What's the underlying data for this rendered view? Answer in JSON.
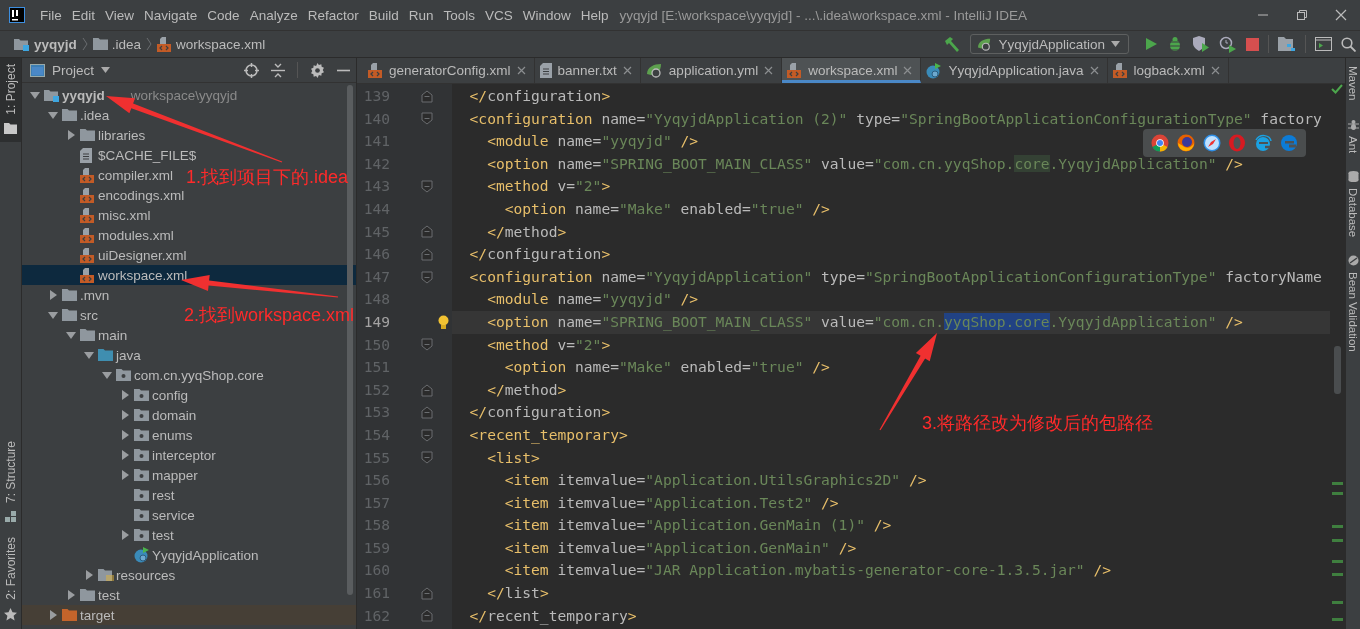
{
  "menu": [
    "File",
    "Edit",
    "View",
    "Navigate",
    "Code",
    "Analyze",
    "Refactor",
    "Build",
    "Run",
    "Tools",
    "VCS",
    "Window",
    "Help"
  ],
  "window_title": "yyqyjd [E:\\workspace\\yyqyjd] - ...\\.idea\\workspace.xml - IntelliJ IDEA",
  "breadcrumbs": [
    {
      "label": "yyqyjd",
      "kind": "project"
    },
    {
      "label": ".idea",
      "kind": "folder"
    },
    {
      "label": "workspace.xml",
      "kind": "xml"
    }
  ],
  "run_config": "YyqyjdApplication",
  "left_strip": [
    {
      "label": "1: Project",
      "selected": true
    },
    {
      "label": "7: Structure",
      "selected": false
    },
    {
      "label": "2: Favorites",
      "selected": false
    }
  ],
  "right_strip": [
    "Maven",
    "Ant",
    "Database",
    "Bean Validation"
  ],
  "project_panel": {
    "title": "Project",
    "tree": [
      {
        "label": "yyqyjd",
        "kind": "project",
        "hint": "workspace\\yyqyjd",
        "expanded": true,
        "selected": false,
        "children": [
          {
            "label": ".idea",
            "kind": "folder",
            "expanded": true,
            "selected": false,
            "children": [
              {
                "label": "libraries",
                "kind": "folder",
                "expanded": false,
                "selected": false
              },
              {
                "label": "$CACHE_FILE$",
                "kind": "text",
                "selected": false
              },
              {
                "label": "compiler.xml",
                "kind": "xml",
                "selected": false
              },
              {
                "label": "encodings.xml",
                "kind": "xml",
                "selected": false
              },
              {
                "label": "misc.xml",
                "kind": "xml",
                "selected": false
              },
              {
                "label": "modules.xml",
                "kind": "xml",
                "selected": false
              },
              {
                "label": "uiDesigner.xml",
                "kind": "xml",
                "selected": false
              },
              {
                "label": "workspace.xml",
                "kind": "xml",
                "selected": true
              }
            ]
          },
          {
            "label": ".mvn",
            "kind": "folder",
            "expanded": false,
            "selected": false
          },
          {
            "label": "src",
            "kind": "folder",
            "expanded": true,
            "selected": false,
            "children": [
              {
                "label": "main",
                "kind": "folder",
                "expanded": true,
                "selected": false,
                "children": [
                  {
                    "label": "java",
                    "kind": "source",
                    "expanded": true,
                    "selected": false,
                    "children": [
                      {
                        "label": "com.cn.yyqShop.core",
                        "kind": "package",
                        "expanded": true,
                        "selected": false,
                        "children": [
                          {
                            "label": "config",
                            "kind": "package",
                            "expanded": false,
                            "selected": false
                          },
                          {
                            "label": "domain",
                            "kind": "package",
                            "expanded": false,
                            "selected": false
                          },
                          {
                            "label": "enums",
                            "kind": "package",
                            "expanded": false,
                            "selected": false
                          },
                          {
                            "label": "interceptor",
                            "kind": "package",
                            "expanded": false,
                            "selected": false
                          },
                          {
                            "label": "mapper",
                            "kind": "package",
                            "expanded": false,
                            "selected": false
                          },
                          {
                            "label": "rest",
                            "kind": "package",
                            "selected": false
                          },
                          {
                            "label": "service",
                            "kind": "package",
                            "selected": false
                          },
                          {
                            "label": "test",
                            "kind": "package",
                            "expanded": false,
                            "selected": false
                          },
                          {
                            "label": "YyqyjdApplication",
                            "kind": "class",
                            "selected": false
                          }
                        ]
                      }
                    ]
                  },
                  {
                    "label": "resources",
                    "kind": "resources",
                    "expanded": false,
                    "selected": false
                  }
                ]
              },
              {
                "label": "test",
                "kind": "folder",
                "expanded": false,
                "selected": false
              }
            ]
          },
          {
            "label": "target",
            "kind": "excluded",
            "expanded": false,
            "selected": false
          }
        ]
      }
    ]
  },
  "tabs": [
    {
      "label": "generatorConfig.xml",
      "kind": "xml",
      "selected": false
    },
    {
      "label": "banner.txt",
      "kind": "text",
      "selected": false
    },
    {
      "label": "application.yml",
      "kind": "yml",
      "selected": false
    },
    {
      "label": "workspace.xml",
      "kind": "xml",
      "selected": true
    },
    {
      "label": "YyqyjdApplication.java",
      "kind": "class",
      "selected": false
    },
    {
      "label": "logback.xml",
      "kind": "xml",
      "selected": false
    }
  ],
  "editor": {
    "lines": [
      {
        "number": "139",
        "kind": "fold-end",
        "current": false,
        "segments": [
          {
            "text": "  </configuration>",
            "kind": "code"
          }
        ]
      },
      {
        "number": "140",
        "kind": "fold-start",
        "current": false,
        "segments": [
          {
            "text": "  <configuration name=\"YyqyjdApplication (2)\" type=\"SpringBootApplicationConfigurationType\" factory",
            "kind": "code"
          }
        ]
      },
      {
        "number": "141",
        "kind": "plain",
        "current": false,
        "segments": [
          {
            "text": "    <module name=\"yyqyjd\" />",
            "kind": "code"
          }
        ]
      },
      {
        "number": "142",
        "kind": "plain",
        "current": false,
        "segments": [
          {
            "text": "    <option name=\"SPRING_BOOT_MAIN_CLASS\" value=\"com.cn.yyqShop.",
            "kind": "code"
          },
          {
            "text": "core",
            "kind": "match"
          },
          {
            "text": ".YyqyjdApplication\" />",
            "kind": "code"
          }
        ]
      },
      {
        "number": "143",
        "kind": "fold-start",
        "current": false,
        "segments": [
          {
            "text": "    <method v=\"2\">",
            "kind": "code"
          }
        ]
      },
      {
        "number": "144",
        "kind": "plain",
        "current": false,
        "segments": [
          {
            "text": "      <option name=\"Make\" enabled=\"true\" />",
            "kind": "code"
          }
        ]
      },
      {
        "number": "145",
        "kind": "fold-end",
        "current": false,
        "segments": [
          {
            "text": "    </method>",
            "kind": "code"
          }
        ]
      },
      {
        "number": "146",
        "kind": "fold-end",
        "current": false,
        "segments": [
          {
            "text": "  </configuration>",
            "kind": "code"
          }
        ]
      },
      {
        "number": "147",
        "kind": "fold-start",
        "current": false,
        "segments": [
          {
            "text": "  <configuration name=\"YyqyjdApplication\" type=\"SpringBootApplicationConfigurationType\" factoryName",
            "kind": "code"
          }
        ]
      },
      {
        "number": "148",
        "kind": "plain",
        "current": false,
        "segments": [
          {
            "text": "    <module name=\"yyqyjd\" />",
            "kind": "code"
          }
        ]
      },
      {
        "number": "149",
        "kind": "plain",
        "current": true,
        "segments": [
          {
            "text": "    <option name=\"SPRING_BOOT_MAIN_CLASS\" value=\"com.cn.",
            "kind": "code"
          },
          {
            "text": "yyqShop.core",
            "kind": "selection"
          },
          {
            "text": ".YyqyjdApplication\" />",
            "kind": "code"
          }
        ]
      },
      {
        "number": "150",
        "kind": "fold-start",
        "current": false,
        "segments": [
          {
            "text": "    <method v=\"2\">",
            "kind": "code"
          }
        ]
      },
      {
        "number": "151",
        "kind": "plain",
        "current": false,
        "segments": [
          {
            "text": "      <option name=\"Make\" enabled=\"true\" />",
            "kind": "code"
          }
        ]
      },
      {
        "number": "152",
        "kind": "fold-end",
        "current": false,
        "segments": [
          {
            "text": "    </method>",
            "kind": "code"
          }
        ]
      },
      {
        "number": "153",
        "kind": "fold-end",
        "current": false,
        "segments": [
          {
            "text": "  </configuration>",
            "kind": "code"
          }
        ]
      },
      {
        "number": "154",
        "kind": "fold-start",
        "current": false,
        "segments": [
          {
            "text": "  <recent_temporary>",
            "kind": "code"
          }
        ]
      },
      {
        "number": "155",
        "kind": "fold-start",
        "current": false,
        "segments": [
          {
            "text": "    <list>",
            "kind": "code"
          }
        ]
      },
      {
        "number": "156",
        "kind": "plain",
        "current": false,
        "segments": [
          {
            "text": "      <item itemvalue=\"Application.UtilsGraphics2D\" />",
            "kind": "code"
          }
        ]
      },
      {
        "number": "157",
        "kind": "plain",
        "current": false,
        "segments": [
          {
            "text": "      <item itemvalue=\"Application.Test2\" />",
            "kind": "code"
          }
        ]
      },
      {
        "number": "158",
        "kind": "plain",
        "current": false,
        "segments": [
          {
            "text": "      <item itemvalue=\"Application.GenMain (1)\" />",
            "kind": "code"
          }
        ]
      },
      {
        "number": "159",
        "kind": "plain",
        "current": false,
        "segments": [
          {
            "text": "      <item itemvalue=\"Application.GenMain\" />",
            "kind": "code"
          }
        ]
      },
      {
        "number": "160",
        "kind": "plain",
        "current": false,
        "segments": [
          {
            "text": "      <item itemvalue=\"JAR Application.mybatis-generator-core-1.3.5.jar\" />",
            "kind": "code"
          }
        ]
      },
      {
        "number": "161",
        "kind": "fold-end",
        "current": false,
        "segments": [
          {
            "text": "    </list>",
            "kind": "code"
          }
        ]
      },
      {
        "number": "162",
        "kind": "fold-end",
        "current": false,
        "segments": [
          {
            "text": "  </recent_temporary>",
            "kind": "code"
          }
        ]
      }
    ]
  },
  "annotations": [
    "1.找到项目下的.idea",
    "2.找到workspace.xml",
    "3.将路径改为修改后的包路径"
  ]
}
